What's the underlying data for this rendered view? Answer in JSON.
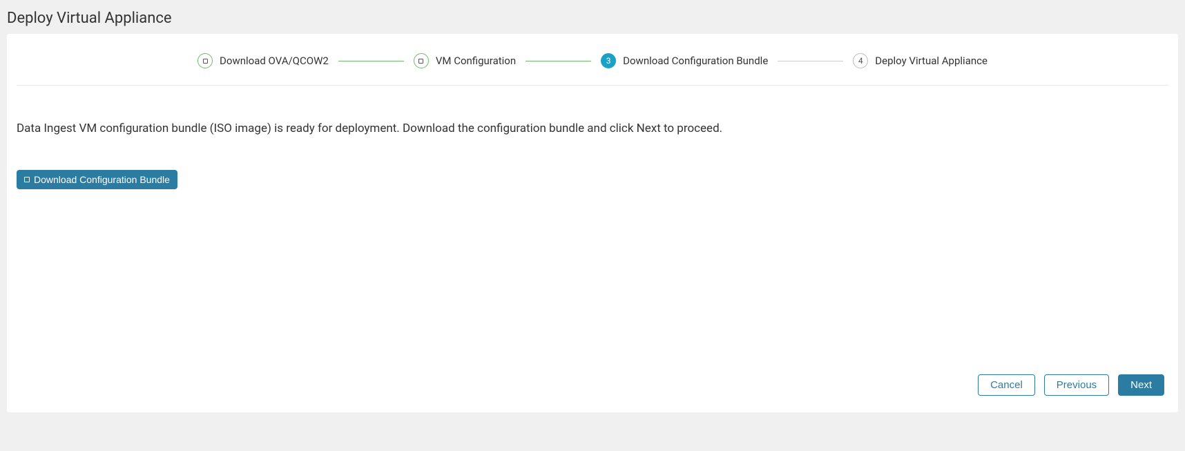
{
  "page": {
    "title": "Deploy Virtual Appliance"
  },
  "stepper": {
    "steps": [
      {
        "label": "Download OVA/QCOW2",
        "state": "completed"
      },
      {
        "label": "VM Configuration",
        "state": "completed"
      },
      {
        "label": "Download Configuration Bundle",
        "state": "active",
        "number": "3"
      },
      {
        "label": "Deploy Virtual Appliance",
        "state": "upcoming",
        "number": "4"
      }
    ]
  },
  "content": {
    "description": "Data Ingest VM configuration bundle (ISO image) is ready for deployment. Download the configuration bundle and click Next to proceed.",
    "download_button_label": "Download Configuration Bundle"
  },
  "footer": {
    "cancel_label": "Cancel",
    "previous_label": "Previous",
    "next_label": "Next"
  }
}
